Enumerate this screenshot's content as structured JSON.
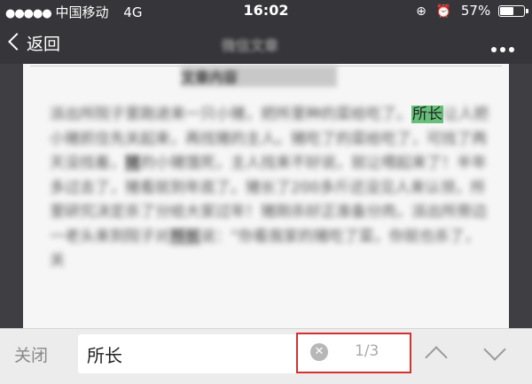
{
  "status_bar": {
    "signal": "●●●●●",
    "carrier": "中国移动",
    "network": "4G",
    "time": "16:02",
    "battery_percent": "57%",
    "battery_level": 0.57
  },
  "nav": {
    "back_label": "返回",
    "title": "微信文章"
  },
  "article": {
    "tag": "文章内容",
    "before_match": "派出所院子里跑进来一只小猪，把所里种的菜给吃了。",
    "match": "所长",
    "after_match": "让人把小猪抓住先关起来，再找猪的主人。猪吃了的菜给吃了，可找了两天没找着，",
    "mid_highlight": "猪",
    "rest_1": "的小猪饿死，主人找来不好说，就让喂起来了！半年多过去了，猪看就到年底了。猪长了200多斤还没见人来认领，所里研究决定杀了分给大家过年！猪刚杀好正准备分肉，派出所旁边一老头来到院子对",
    "end_highlight": "所长",
    "rest_2": "说：“你看我家的猪吃了菜，你就也杀了，关"
  },
  "find_bar": {
    "close_label": "关闭",
    "query": "所长",
    "clear_icon": "✕",
    "match_count": "1/3"
  }
}
